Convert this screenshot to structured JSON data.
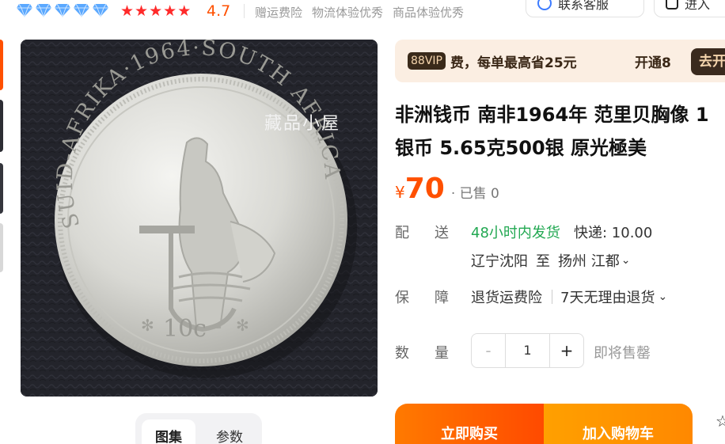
{
  "shop": {
    "diamond_count": 5,
    "star_count": 5,
    "rating": "4.7",
    "tags": [
      "赠运费险",
      "物流体验优秀",
      "商品体验优秀"
    ],
    "service_button": "联系客服",
    "shop_button": "进入"
  },
  "colors": {
    "accent": "#ff5000",
    "star": "#ff2a2a",
    "diamond": "#5aa8ff",
    "green": "#22a852"
  },
  "gallery": {
    "watermark": "藏品小屋",
    "tabs": [
      "图集",
      "参数"
    ],
    "coin_legend": "SUID-AFRIKA·1964·SOUTH AFRICA",
    "coin_value": "10c"
  },
  "vip": {
    "badge": "88VIP",
    "text": "费，每单最高省25元",
    "open": "开通8",
    "go": "去开"
  },
  "product": {
    "title_line1": "非洲钱币 南非1964年 范里贝胸像 1",
    "title_line2": "银币 5.65克500银 原光極美",
    "price_symbol": "¥",
    "price": "70",
    "sold": "· 已售 0"
  },
  "shipping": {
    "label": "配送",
    "promise": "48小时内发货",
    "fee": "快递: 10.00",
    "from": "辽宁沈阳",
    "to_word": "至",
    "dest": "扬州 江都"
  },
  "guarantee": {
    "label": "保障",
    "items": [
      "退货运费险",
      "7天无理由退货"
    ]
  },
  "quantity": {
    "label": "数量",
    "minus": "-",
    "value": "1",
    "plus": "+",
    "note": "即将售罄"
  },
  "actions": {
    "buy_now": "立即购买",
    "add_cart": "加入购物车"
  }
}
